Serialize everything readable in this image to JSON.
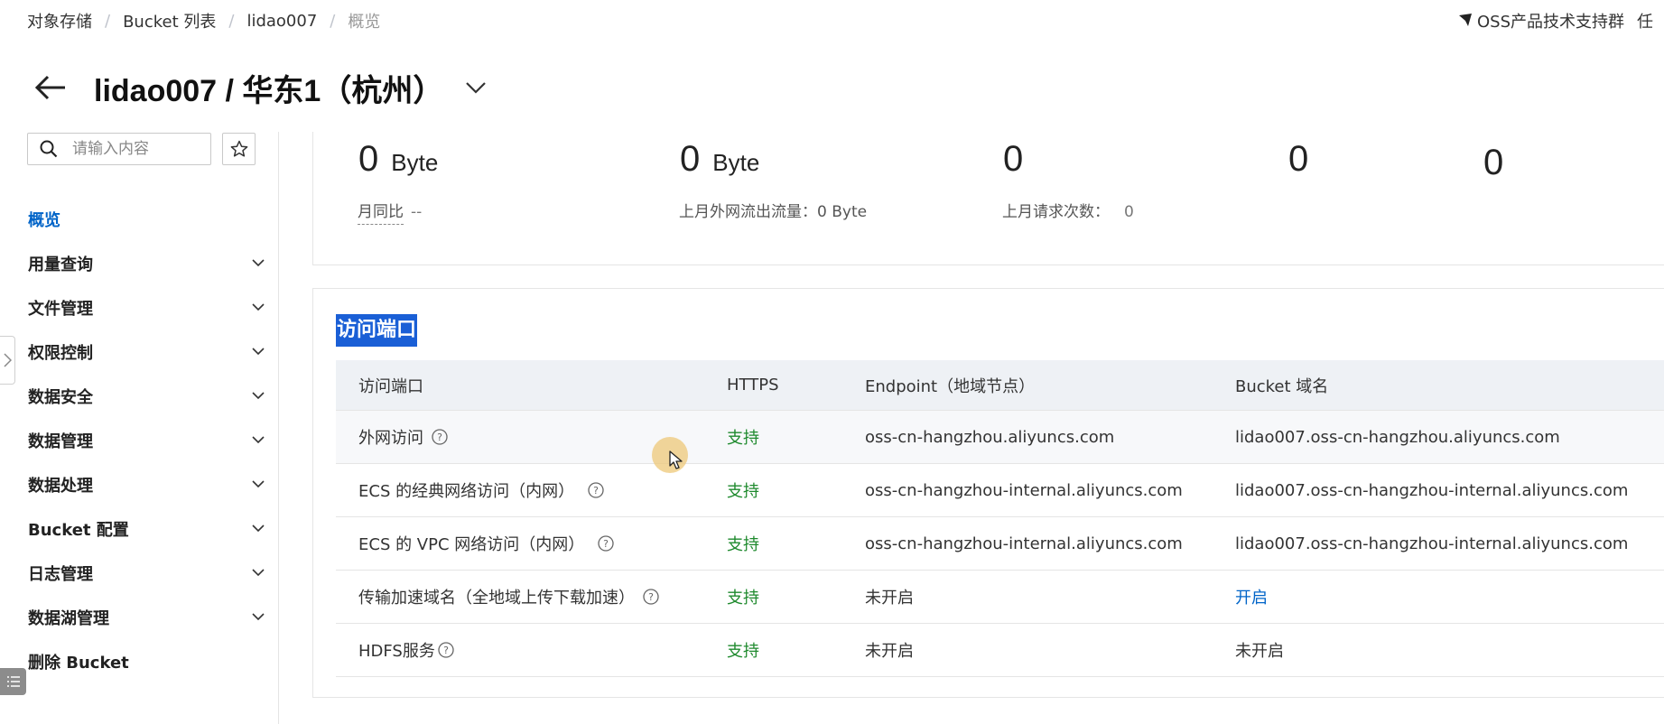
{
  "breadcrumb": [
    "对象存储",
    "Bucket 列表",
    "lidao007",
    "概览"
  ],
  "support": {
    "label": "OSS产品技术支持群",
    "extra": "任"
  },
  "header": {
    "title": "lidao007 / 华东1（杭州）"
  },
  "sidebar": {
    "search_placeholder": "请输入内容",
    "items": [
      {
        "label": "概览"
      },
      {
        "label": "用量查询"
      },
      {
        "label": "文件管理"
      },
      {
        "label": "权限控制"
      },
      {
        "label": "数据安全"
      },
      {
        "label": "数据管理"
      },
      {
        "label": "数据处理"
      },
      {
        "label": "Bucket 配置"
      },
      {
        "label": "日志管理"
      },
      {
        "label": "数据湖管理"
      },
      {
        "label": "删除 Bucket"
      }
    ]
  },
  "stats": [
    {
      "value": "0",
      "unit": "Byte"
    },
    {
      "value": "0",
      "unit": "Byte"
    },
    {
      "value": "0",
      "unit": ""
    },
    {
      "value": "0",
      "unit": ""
    },
    {
      "value": "0",
      "unit": ""
    }
  ],
  "stats_sub": [
    {
      "label": "月同比",
      "value": "--"
    },
    {
      "label": "上月外网流出流量：",
      "value": "0 Byte"
    },
    {
      "label": "上月请求次数：",
      "value": "0"
    }
  ],
  "access": {
    "title": "访问端口",
    "columns": [
      "访问端口",
      "HTTPS",
      "Endpoint（地域节点）",
      "Bucket 域名"
    ],
    "rows": [
      {
        "name": "外网访问",
        "https": "支持",
        "endpoint": "oss-cn-hangzhou.aliyuncs.com",
        "domain": "lidao007.oss-cn-hangzhou.aliyuncs.com"
      },
      {
        "name": "ECS 的经典网络访问（内网）",
        "https": "支持",
        "endpoint": "oss-cn-hangzhou-internal.aliyuncs.com",
        "domain": "lidao007.oss-cn-hangzhou-internal.aliyuncs.com"
      },
      {
        "name": "ECS 的 VPC 网络访问（内网）",
        "https": "支持",
        "endpoint": "oss-cn-hangzhou-internal.aliyuncs.com",
        "domain": "lidao007.oss-cn-hangzhou-internal.aliyuncs.com"
      },
      {
        "name": "传输加速域名（全地域上传下载加速）",
        "https": "支持",
        "endpoint": "未开启",
        "domain": "开启"
      },
      {
        "name": "HDFS服务",
        "https": "支持",
        "endpoint": "未开启",
        "domain": "未开启"
      }
    ]
  },
  "colors": {
    "accent": "#0064c8",
    "success": "#1f8a2e",
    "highlight": "#1a5fd6"
  }
}
